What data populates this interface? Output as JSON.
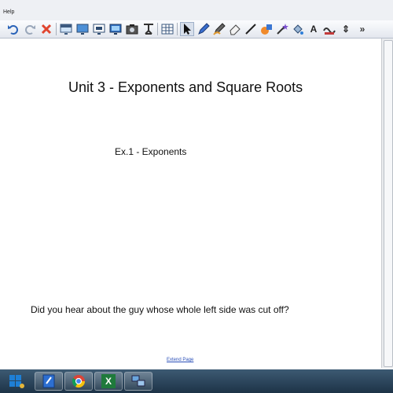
{
  "menubar": {
    "help_label": "Help"
  },
  "toolbar": {
    "tools": [
      "undo-icon",
      "redo-icon",
      "delete-icon",
      "screen-shade-icon",
      "display-icon",
      "screen-capture-icon",
      "presentation-icon",
      "camera-icon",
      "document-camera-icon",
      "table-icon",
      "select-icon",
      "pen-icon",
      "creative-pen-icon",
      "eraser-icon",
      "line-icon",
      "shapes-icon",
      "magic-pen-icon",
      "fill-icon",
      "text-icon",
      "properties-icon",
      "move-toolbar-icon",
      "more-icon"
    ],
    "text_tool_glyph": "A",
    "move_glyph": "⇕",
    "more_glyph": "»"
  },
  "page": {
    "title": "Unit 3 - Exponents and Square Roots",
    "subtitle": "Ex.1 - Exponents",
    "joke": "Did you hear about the guy whose whole left side was cut off?",
    "extend_link": "Extend Page"
  },
  "taskbar": {
    "items": [
      "start-button",
      "notebook-app-icon",
      "chrome-app-icon",
      "excel-app-icon",
      "network-app-icon"
    ],
    "excel_glyph": "X"
  }
}
